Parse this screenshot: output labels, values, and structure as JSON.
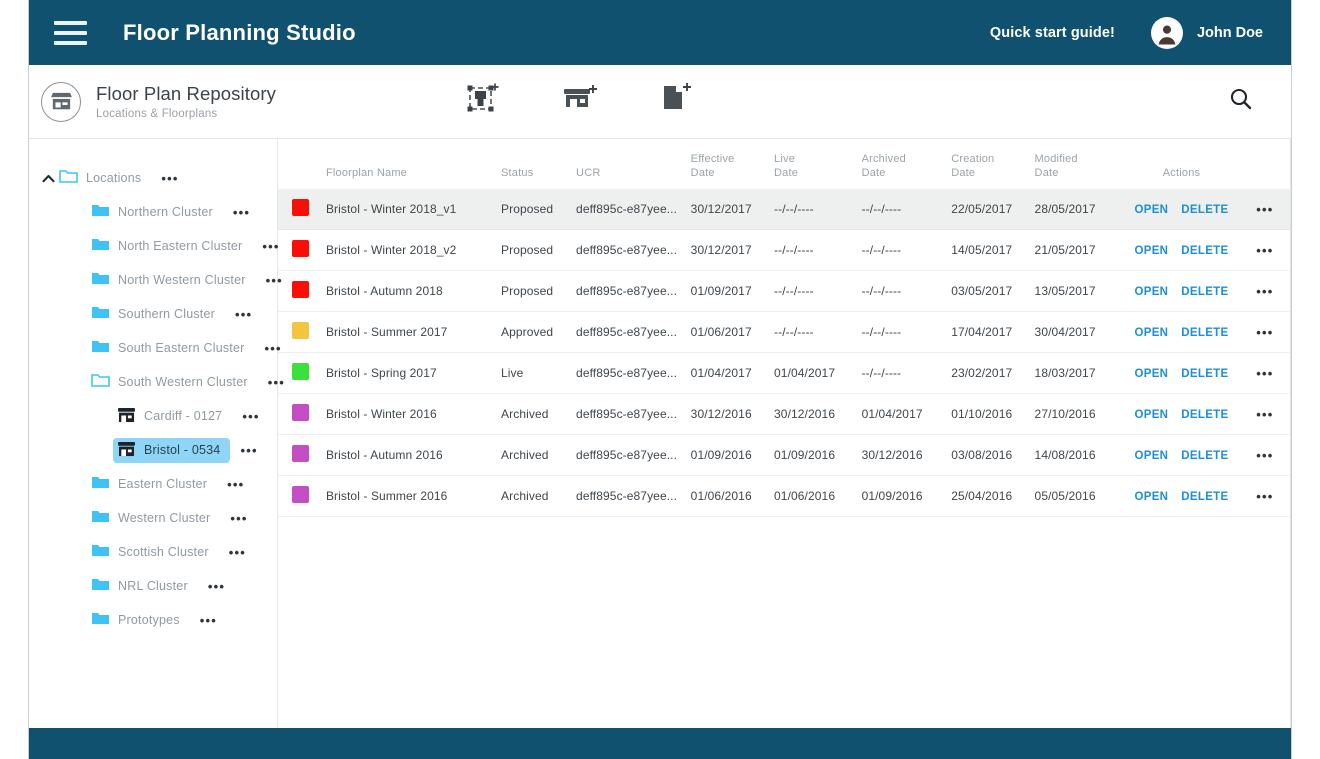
{
  "navbar": {
    "menu_icon": "hamburger-icon",
    "title": "Floor Planning Studio",
    "quick_start": "Quick start guide!",
    "user_name": "John Doe",
    "avatar_icon": "user-avatar-icon",
    "background_color": "#10516f"
  },
  "subheader": {
    "badge_icon": "store-icon",
    "title": "Floor Plan Repository",
    "subtitle": "Locations & Floorplans",
    "tools": [
      {
        "name": "add-cluster-icon",
        "label": "Add Cluster"
      },
      {
        "name": "add-store-icon",
        "label": "Add Store"
      },
      {
        "name": "add-floorplan-icon",
        "label": "Add Floorplan"
      }
    ],
    "search_icon": "search-icon"
  },
  "sidebar": {
    "items": [
      {
        "label": "Locations",
        "type": "folder-open",
        "depth": 0,
        "caret": "˄",
        "selected": false
      },
      {
        "label": "Northern Cluster",
        "type": "folder",
        "depth": 1,
        "caret": "",
        "selected": false
      },
      {
        "label": "North Eastern Cluster",
        "type": "folder",
        "depth": 1,
        "caret": "",
        "selected": false
      },
      {
        "label": "North Western Cluster",
        "type": "folder",
        "depth": 1,
        "caret": "",
        "selected": false
      },
      {
        "label": "Southern Cluster",
        "type": "folder",
        "depth": 1,
        "caret": "",
        "selected": false
      },
      {
        "label": "South Eastern Cluster",
        "type": "folder",
        "depth": 1,
        "caret": "",
        "selected": false
      },
      {
        "label": "South Western Cluster",
        "type": "folder-open",
        "depth": 1,
        "caret": "",
        "selected": false
      },
      {
        "label": "Cardiff - 0127",
        "type": "store",
        "depth": 2,
        "caret": "",
        "selected": false
      },
      {
        "label": "Bristol - 0534",
        "type": "store",
        "depth": 2,
        "caret": "",
        "selected": true
      },
      {
        "label": "Eastern Cluster",
        "type": "folder",
        "depth": 1,
        "caret": "",
        "selected": false
      },
      {
        "label": "Western Cluster",
        "type": "folder",
        "depth": 1,
        "caret": "",
        "selected": false
      },
      {
        "label": "Scottish Cluster",
        "type": "folder",
        "depth": 1,
        "caret": "",
        "selected": false
      },
      {
        "label": "NRL Cluster",
        "type": "folder",
        "depth": 1,
        "caret": "",
        "selected": false
      },
      {
        "label": "Prototypes",
        "type": "folder",
        "depth": 1,
        "caret": "",
        "selected": false
      }
    ],
    "menu_dots": "•••"
  },
  "table": {
    "columns": [
      {
        "key": "swatch",
        "label": ""
      },
      {
        "key": "name",
        "label": "Floorplan Name"
      },
      {
        "key": "status",
        "label": "Status"
      },
      {
        "key": "ucr",
        "label": "UCR"
      },
      {
        "key": "effective",
        "label": "Effective Date"
      },
      {
        "key": "live",
        "label": "Live Date"
      },
      {
        "key": "archived",
        "label": "Archived Date"
      },
      {
        "key": "creation",
        "label": "Creation Date"
      },
      {
        "key": "modified",
        "label": "Modified Date"
      },
      {
        "key": "actions",
        "label": "Actions"
      },
      {
        "key": "more",
        "label": ""
      }
    ],
    "actions": {
      "open": "OPEN",
      "delete": "DELETE",
      "more": "•••"
    },
    "empty_date": "--/--/----",
    "status_colors": {
      "Proposed": "#fb0d08",
      "Approved": "#f5c43f",
      "Live": "#3ce03c",
      "Archived": "#c44fc4"
    },
    "rows": [
      {
        "name": "Bristol - Winter 2018_v1",
        "status": "Proposed",
        "ucr": "deff895c-e87yee...",
        "effective": "30/12/2017",
        "live": "--/--/----",
        "archived": "--/--/----",
        "creation": "22/05/2017",
        "modified": "28/05/2017",
        "selected": true
      },
      {
        "name": "Bristol - Winter 2018_v2",
        "status": "Proposed",
        "ucr": "deff895c-e87yee...",
        "effective": "30/12/2017",
        "live": "--/--/----",
        "archived": "--/--/----",
        "creation": "14/05/2017",
        "modified": "21/05/2017",
        "selected": false
      },
      {
        "name": "Bristol - Autumn 2018",
        "status": "Proposed",
        "ucr": "deff895c-e87yee...",
        "effective": "01/09/2017",
        "live": "--/--/----",
        "archived": "--/--/----",
        "creation": "03/05/2017",
        "modified": "13/05/2017",
        "selected": false
      },
      {
        "name": "Bristol - Summer 2017",
        "status": "Approved",
        "ucr": "deff895c-e87yee...",
        "effective": "01/06/2017",
        "live": "--/--/----",
        "archived": "--/--/----",
        "creation": "17/04/2017",
        "modified": "30/04/2017",
        "selected": false
      },
      {
        "name": "Bristol - Spring 2017",
        "status": "Live",
        "ucr": "deff895c-e87yee...",
        "effective": "01/04/2017",
        "live": "01/04/2017",
        "archived": "--/--/----",
        "creation": "23/02/2017",
        "modified": "18/03/2017",
        "selected": false
      },
      {
        "name": "Bristol - Winter 2016",
        "status": "Archived",
        "ucr": "deff895c-e87yee...",
        "effective": "30/12/2016",
        "live": "30/12/2016",
        "archived": "01/04/2017",
        "creation": "01/10/2016",
        "modified": "27/10/2016",
        "selected": false
      },
      {
        "name": "Bristol - Autumn 2016",
        "status": "Archived",
        "ucr": "deff895c-e87yee...",
        "effective": "01/09/2016",
        "live": "01/09/2016",
        "archived": "30/12/2016",
        "creation": "03/08/2016",
        "modified": "14/08/2016",
        "selected": false
      },
      {
        "name": "Bristol - Summer 2016",
        "status": "Archived",
        "ucr": "deff895c-e87yee...",
        "effective": "01/06/2016",
        "live": "01/06/2016",
        "archived": "01/09/2016",
        "creation": "25/04/2016",
        "modified": "05/05/2016",
        "selected": false
      }
    ]
  },
  "footer": {
    "background_color": "#10516f"
  }
}
